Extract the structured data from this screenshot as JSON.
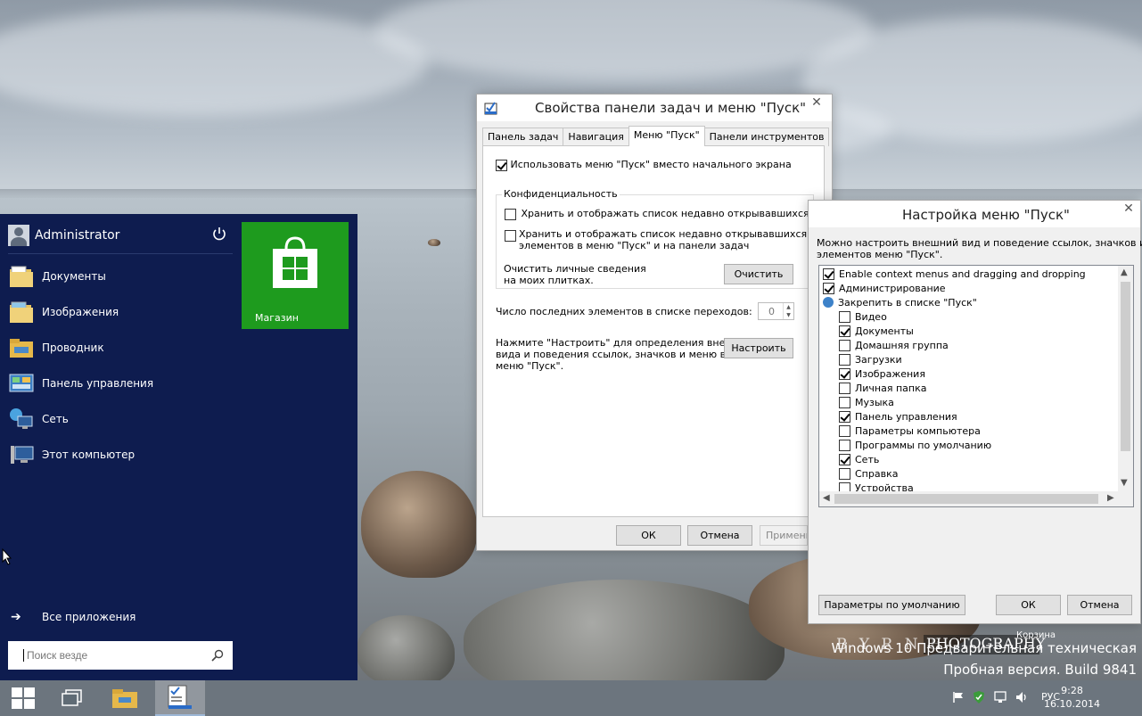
{
  "desktop": {
    "watermark_brand": "B Y R N E",
    "watermark_photo": "PHOTOGRAPHY",
    "watermark_korzina": "Корзина",
    "build_line1": "Windows 10 Предварительная техническая",
    "build_line2": "Пробная версия. Build 9841"
  },
  "start_menu": {
    "username": "Administrator",
    "items": [
      {
        "label": "Документы",
        "icon": "documents-folder-icon"
      },
      {
        "label": "Изображения",
        "icon": "pictures-folder-icon"
      },
      {
        "label": "Проводник",
        "icon": "explorer-icon"
      },
      {
        "label": "Панель управления",
        "icon": "control-panel-icon"
      },
      {
        "label": "Сеть",
        "icon": "network-icon"
      },
      {
        "label": "Этот компьютер",
        "icon": "computer-icon"
      }
    ],
    "tile_label": "Магазин",
    "all_apps": "Все приложения",
    "search_placeholder": "Поиск везде"
  },
  "taskbar_dialog": {
    "title": "Свойства панели задач и меню \"Пуск\"",
    "tabs": [
      "Панель задач",
      "Навигация",
      "Меню \"Пуск\"",
      "Панели инструментов"
    ],
    "active_tab": 2,
    "use_start_menu": "Использовать меню \"Пуск\" вместо начального экрана",
    "privacy_group": "Конфиденциальность",
    "privacy_opt1": "Хранить и отображать список недавно открывавшихся",
    "privacy_opt2_line1": "Хранить и отображать список недавно открывавшихся",
    "privacy_opt2_line2": "элементов в меню \"Пуск\" и на панели задач",
    "clear_text_line1": "Очистить личные сведения",
    "clear_text_line2": "на моих плитках.",
    "clear_button": "Очистить",
    "jump_list_label": "Число последних элементов в списке переходов:",
    "jump_list_value": "0",
    "customize_text_line1": "Нажмите \"Настроить\" для определения внешнего",
    "customize_text_line2": "вида и поведения ссылок, значков и меню в",
    "customize_text_line3": "меню \"Пуск\".",
    "customize_button": "Настроить",
    "ok": "ОК",
    "cancel": "Отмена",
    "apply": "Применить"
  },
  "customize_dialog": {
    "title": "Настройка меню \"Пуск\"",
    "description_line1": "Можно настроить внешний вид и поведение ссылок, значков и",
    "description_line2": "элементов меню \"Пуск\".",
    "list": [
      {
        "label": "Enable context menus and dragging and dropping",
        "checked": true,
        "indent": 0,
        "type": "check"
      },
      {
        "label": "Администрирование",
        "checked": true,
        "indent": 0,
        "type": "check"
      },
      {
        "label": "Закрепить в списке \"Пуск\"",
        "checked": false,
        "indent": 0,
        "type": "pin"
      },
      {
        "label": "Видео",
        "checked": false,
        "indent": 1,
        "type": "check"
      },
      {
        "label": "Документы",
        "checked": true,
        "indent": 1,
        "type": "check"
      },
      {
        "label": "Домашняя группа",
        "checked": false,
        "indent": 1,
        "type": "check"
      },
      {
        "label": "Загрузки",
        "checked": false,
        "indent": 1,
        "type": "check"
      },
      {
        "label": "Изображения",
        "checked": true,
        "indent": 1,
        "type": "check"
      },
      {
        "label": "Личная папка",
        "checked": false,
        "indent": 1,
        "type": "check"
      },
      {
        "label": "Музыка",
        "checked": false,
        "indent": 1,
        "type": "check"
      },
      {
        "label": "Панель управления",
        "checked": true,
        "indent": 1,
        "type": "check"
      },
      {
        "label": "Параметры компьютера",
        "checked": false,
        "indent": 1,
        "type": "check"
      },
      {
        "label": "Программы по умолчанию",
        "checked": false,
        "indent": 1,
        "type": "check"
      },
      {
        "label": "Сеть",
        "checked": true,
        "indent": 1,
        "type": "check"
      },
      {
        "label": "Справка",
        "checked": false,
        "indent": 1,
        "type": "check"
      },
      {
        "label": "Устройства",
        "checked": false,
        "indent": 1,
        "type": "check"
      }
    ],
    "defaults_button": "Параметры по умолчанию",
    "ok": "ОК",
    "cancel": "Отмена"
  },
  "taskbar": {
    "language": "РУС",
    "time": "9:28",
    "date": "16.10.2014"
  }
}
